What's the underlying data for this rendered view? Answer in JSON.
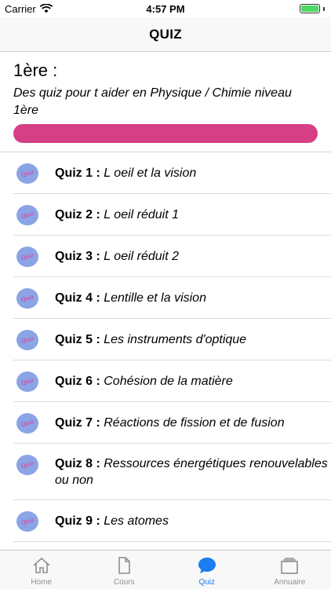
{
  "status": {
    "carrier": "Carrier",
    "time": "4:57 PM"
  },
  "nav": {
    "title": "QUIZ"
  },
  "header": {
    "level": "1ère :",
    "description": "Des quiz pour t aider en Physique / Chimie niveau 1ère",
    "bar_color": "#d63e86"
  },
  "quizzes": [
    {
      "label": "Quiz 1 :",
      "title": "L oeil et la vision"
    },
    {
      "label": "Quiz 2 :",
      "title": "L oeil réduit 1"
    },
    {
      "label": "Quiz 3 :",
      "title": "L oeil réduit 2"
    },
    {
      "label": "Quiz 4 :",
      "title": "Lentille et la vision"
    },
    {
      "label": "Quiz 5 :",
      "title": "Les instruments d'optique"
    },
    {
      "label": "Quiz 6 :",
      "title": "Cohésion de la matière"
    },
    {
      "label": "Quiz 7 :",
      "title": "Réactions de fission et de fusion"
    },
    {
      "label": "Quiz 8 :",
      "title": "Ressources énergétiques renouvelables ou non"
    },
    {
      "label": "Quiz 9 :",
      "title": "Les atomes"
    }
  ],
  "quiz_icon_text": "Quiz",
  "tabs": [
    {
      "label": "Home",
      "icon": "home-icon",
      "active": false
    },
    {
      "label": "Cours",
      "icon": "document-icon",
      "active": false
    },
    {
      "label": "Quiz",
      "icon": "chat-bubble-icon",
      "active": true
    },
    {
      "label": "Annuaire",
      "icon": "stack-icon",
      "active": false
    }
  ],
  "colors": {
    "accent": "#1a7df0",
    "inactive": "#8e8e93",
    "quiz_icon_bg": "#8aa4e6"
  }
}
